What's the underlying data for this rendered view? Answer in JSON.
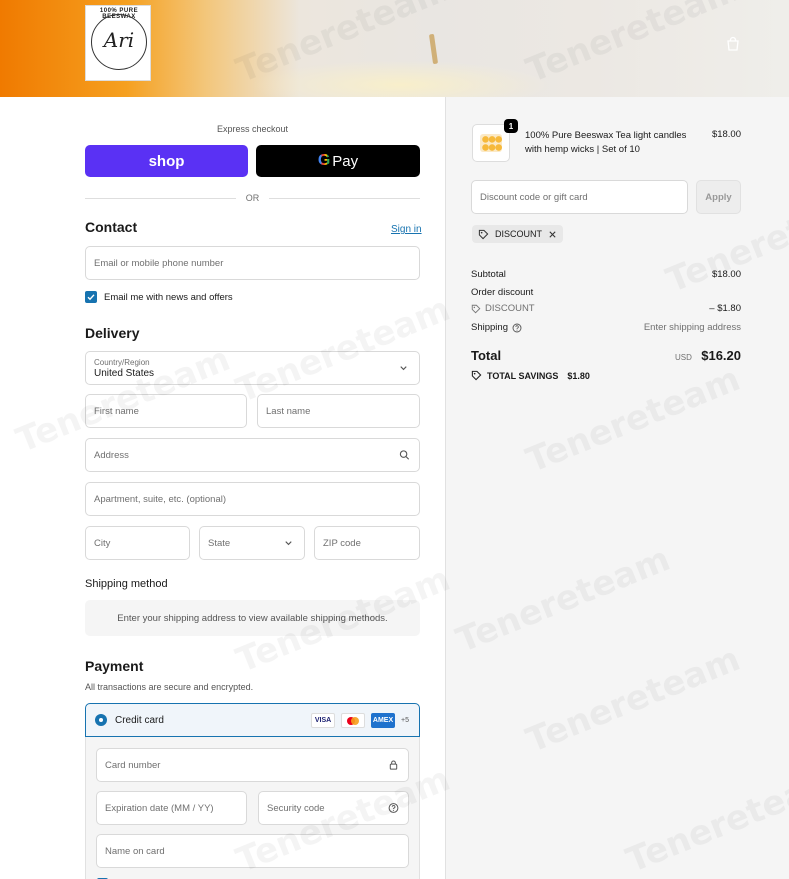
{
  "brand": {
    "logo_top_text": "100% PURE BEESWAX",
    "logo_script": "Ari"
  },
  "express": {
    "label": "Express checkout",
    "shop_label": "shop",
    "gpay_g": "G",
    "gpay_label": "Pay",
    "or_text": "OR"
  },
  "contact": {
    "title": "Contact",
    "signin": "Sign in",
    "email_placeholder": "Email or mobile phone number",
    "news_label": "Email me with news and offers"
  },
  "delivery": {
    "title": "Delivery",
    "country_label": "Country/Region",
    "country_value": "United States",
    "first_name": "First name",
    "last_name": "Last name",
    "address": "Address",
    "apartment": "Apartment, suite, etc. (optional)",
    "city": "City",
    "state": "State",
    "zip": "ZIP code"
  },
  "shipping": {
    "title": "Shipping method",
    "message": "Enter your shipping address to view available shipping methods."
  },
  "payment": {
    "title": "Payment",
    "subtitle": "All transactions are secure and encrypted.",
    "method": "Credit card",
    "cards": [
      "VISA",
      "",
      "AMEX"
    ],
    "more": "+5",
    "card_number": "Card number",
    "expiration": "Expiration date (MM / YY)",
    "security_code": "Security code",
    "name_on_card": "Name on card"
  },
  "order": {
    "quantity": "1",
    "product_name": "100% Pure Beeswax Tea light candles with hemp wicks | Set of 10",
    "product_price": "$18.00",
    "discount_placeholder": "Discount code or gift card",
    "apply": "Apply",
    "chip_code": "DISCOUNT",
    "subtotal_label": "Subtotal",
    "subtotal_value": "$18.00",
    "order_discount_label": "Order discount",
    "discount_code": "DISCOUNT",
    "discount_value": "– $1.80",
    "shipping_label": "Shipping",
    "shipping_value": "Enter shipping address",
    "total_label": "Total",
    "currency": "USD",
    "total_value": "$16.20",
    "savings_label": "TOTAL SAVINGS",
    "savings_value": "$1.80"
  },
  "colors": {
    "accent": "#1773b0",
    "shop_purple": "#5a31f4",
    "summary_bg": "#f5f5f5"
  },
  "watermark": "Tenereteam"
}
